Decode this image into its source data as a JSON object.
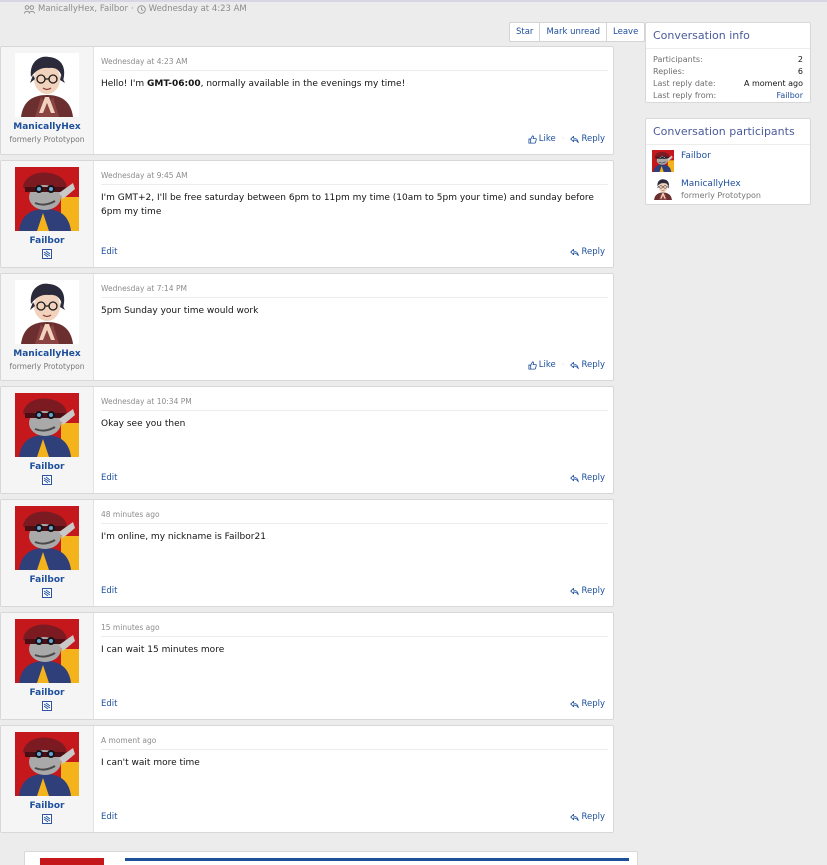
{
  "header": {
    "participants_text": "ManicallyHex, Failbor",
    "separator": "·",
    "started_text": "Wednesday at 4:23 AM"
  },
  "actions": {
    "star": "Star",
    "mark_unread": "Mark unread",
    "leave": "Leave"
  },
  "messages": [
    {
      "user": "ManicallyHex",
      "user_title": "formerly Prototypon",
      "date": "Wednesday at 4:23 AM",
      "body_before": "Hello! I'm ",
      "body_bold": "GMT-06:00",
      "body_after": ", normally available in the evenings my time!",
      "like": "Like",
      "reply": "Reply"
    },
    {
      "user": "Failbor",
      "date": "Wednesday at 9:45 AM",
      "body": "I'm GMT+2, I'll be free saturday between 6pm to 11pm my time (10am to 5pm your time) and sunday before 6pm my time",
      "edit": "Edit",
      "reply": "Reply"
    },
    {
      "user": "ManicallyHex",
      "user_title": "formerly Prototypon",
      "date": "Wednesday at 7:14 PM",
      "body": "5pm Sunday your time would work",
      "like": "Like",
      "reply": "Reply"
    },
    {
      "user": "Failbor",
      "date": "Wednesday at 10:34 PM",
      "body": "Okay see you then",
      "edit": "Edit",
      "reply": "Reply"
    },
    {
      "user": "Failbor",
      "date": "48 minutes ago",
      "body": "I'm online, my nickname is Failbor21",
      "edit": "Edit",
      "reply": "Reply"
    },
    {
      "user": "Failbor",
      "date": "15 minutes ago",
      "body": "I can wait 15 minutes more",
      "edit": "Edit",
      "reply": "Reply"
    },
    {
      "user": "Failbor",
      "date": "A moment ago",
      "body": "I can't wait more time",
      "edit": "Edit",
      "reply": "Reply"
    }
  ],
  "conversation_info": {
    "title": "Conversation info",
    "rows": [
      {
        "label": "Participants:",
        "value": "2"
      },
      {
        "label": "Replies:",
        "value": "6"
      },
      {
        "label": "Last reply date:",
        "value": "A moment ago"
      },
      {
        "label": "Last reply from:",
        "value": "Failbor"
      }
    ]
  },
  "conversation_participants": {
    "title": "Conversation participants",
    "list": [
      {
        "name": "Failbor",
        "title": ""
      },
      {
        "name": "ManicallyHex",
        "title": "formerly Prototypon"
      }
    ]
  },
  "colors": {
    "link": "#1d4f9b",
    "sidebar_heading": "#4b5b9b",
    "failbor_avatar_bg": "#c4181d"
  },
  "icons": [
    "participants-icon",
    "clock-icon",
    "like-icon",
    "reply-icon",
    "badge-icon"
  ]
}
